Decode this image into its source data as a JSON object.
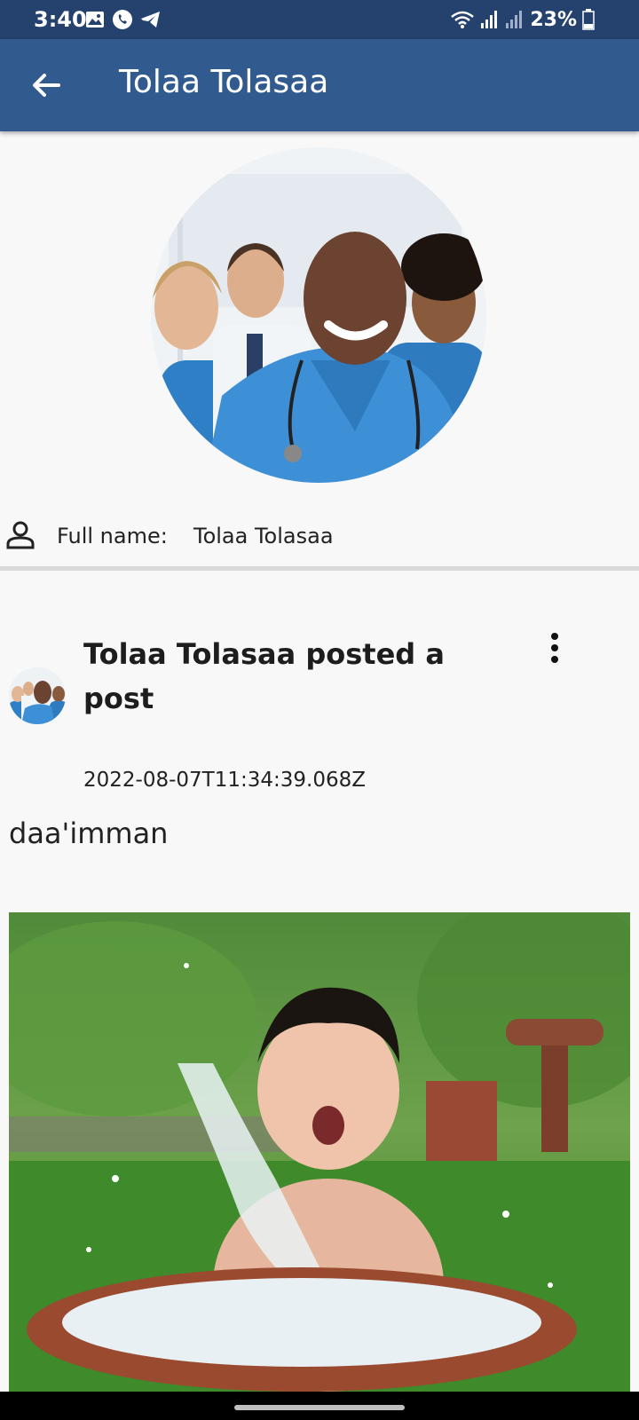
{
  "status_bar": {
    "time": "3:40",
    "battery": "23%",
    "icons": [
      "gallery-icon",
      "whatsapp-icon",
      "telegram-icon",
      "wifi-icon",
      "signal-icon",
      "signal-icon",
      "battery-icon"
    ]
  },
  "app_bar": {
    "title": "Tolaa Tolasaa",
    "back_icon": "arrow-left-icon",
    "color": "#315a8f"
  },
  "profile": {
    "full_name_label": "Full name:",
    "full_name_value": "Tolaa Tolasaa",
    "avatar": "avatar-medical-team-photo"
  },
  "post": {
    "title": "Tolaa Tolasaa posted a post",
    "timestamp": "2022-08-07T11:34:39.068Z",
    "text": "daa'imman",
    "menu_icon": "more-vert-icon",
    "image": "baby-splashing-water-photo"
  }
}
